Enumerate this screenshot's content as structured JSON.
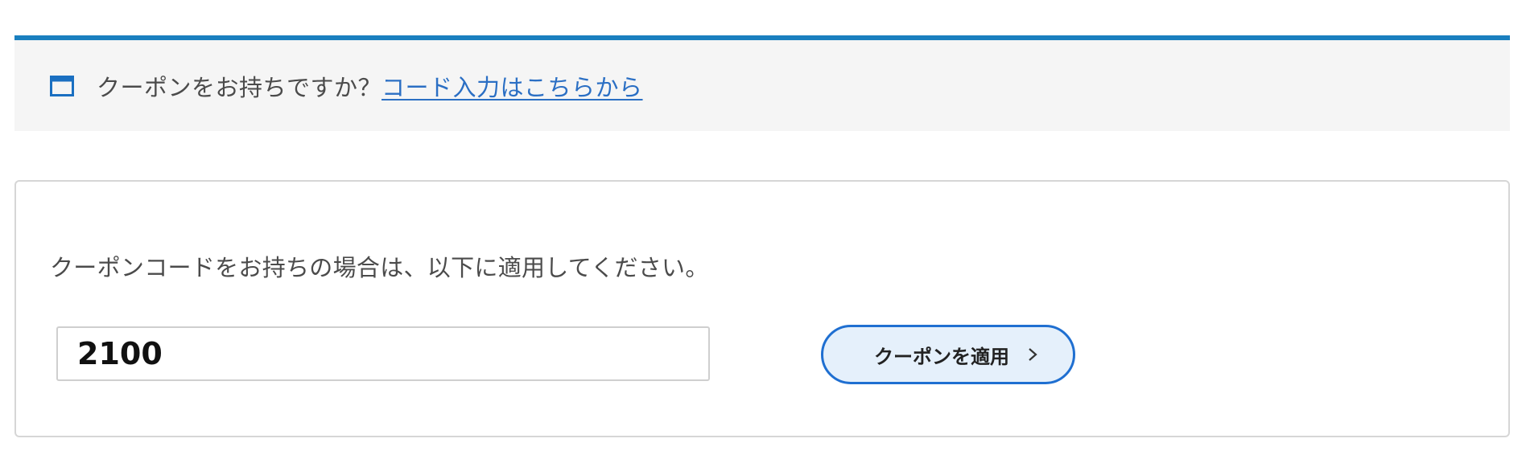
{
  "notice": {
    "icon": "window-icon",
    "text": "クーポンをお持ちですか？",
    "link_label": "コード入力はこちらから",
    "accent_color": "#1a7fbf",
    "link_color": "#2b6fc4"
  },
  "coupon": {
    "description": "クーポンコードをお持ちの場合は、以下に適用してください。",
    "input_value": "2100",
    "apply_button_label": "クーポンを適用",
    "apply_button_icon": "chevron-right-icon",
    "button_border_color": "#1f6fd1",
    "button_fill_color": "#e5f0fb"
  }
}
